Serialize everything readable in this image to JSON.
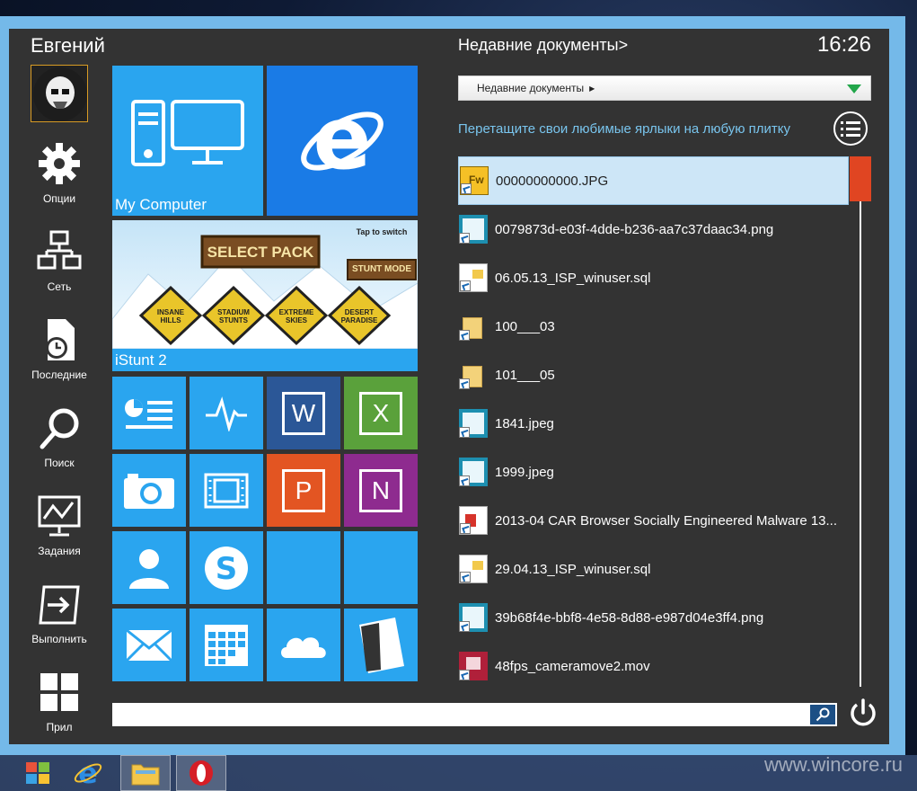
{
  "user": {
    "name": "Евгений"
  },
  "sidebar": {
    "items": [
      {
        "label": "Опции",
        "icon": "gear-icon"
      },
      {
        "label": "Сеть",
        "icon": "network-icon"
      },
      {
        "label": "Последние",
        "icon": "recent-document-icon"
      },
      {
        "label": "Поиск",
        "icon": "search-icon"
      },
      {
        "label": "Задания",
        "icon": "task-monitor-icon"
      },
      {
        "label": "Выполнить",
        "icon": "run-icon"
      },
      {
        "label": "Прил",
        "icon": "apps-grid-icon"
      }
    ]
  },
  "tiles": {
    "my_computer": "My Computer",
    "istunt": "iStunt 2",
    "game_banner": "SELECT PACK",
    "game_tap": "Tap to switch",
    "game_mode": "STUNT MODE",
    "game_signs": [
      "INSANE HILLS",
      "STADIUM STUNTS",
      "EXTREME SKIES",
      "DESERT PARADISE"
    ],
    "word_letter": "W",
    "excel_letter": "X",
    "powerpoint_letter": "P",
    "onenote_letter": "N"
  },
  "recent": {
    "title": "Недавние документы>",
    "combo_value": "Недавние документы",
    "hint": "Перетащите свои любимые ярлыки на любую плитку",
    "files": [
      {
        "name": "00000000000.JPG",
        "icon": "fireworks-file-icon"
      },
      {
        "name": "0079873d-e03f-4dde-b236-aa7c37daac34.png",
        "icon": "image-file-icon"
      },
      {
        "name": "06.05.13_ISP_winuser.sql",
        "icon": "sql-file-icon"
      },
      {
        "name": "100___03",
        "icon": "folder-icon"
      },
      {
        "name": "101___05",
        "icon": "folder-icon"
      },
      {
        "name": "1841.jpeg",
        "icon": "image-file-icon"
      },
      {
        "name": "1999.jpeg",
        "icon": "image-file-icon"
      },
      {
        "name": "2013-04 CAR Browser Socially Engineered Malware 13...",
        "icon": "pdf-file-icon"
      },
      {
        "name": "29.04.13_ISP_winuser.sql",
        "icon": "sql-file-icon"
      },
      {
        "name": "39b68f4e-bbf8-4e58-8d88-e987d04e3ff4.png",
        "icon": "image-file-icon"
      },
      {
        "name": "48fps_cameramove2.mov",
        "icon": "video-file-icon"
      }
    ]
  },
  "clock": "16:26",
  "search": {
    "placeholder": ""
  },
  "watermark": "www.wincore.ru",
  "colors": {
    "accent_blue": "#2aa5ef",
    "ie_blue": "#1a7be6",
    "word": "#2b5797",
    "excel": "#5aa13b",
    "powerpoint": "#e35522",
    "onenote": "#8e2b8f",
    "menu_bg": "#333333",
    "scroll_thumb": "#e04522"
  }
}
